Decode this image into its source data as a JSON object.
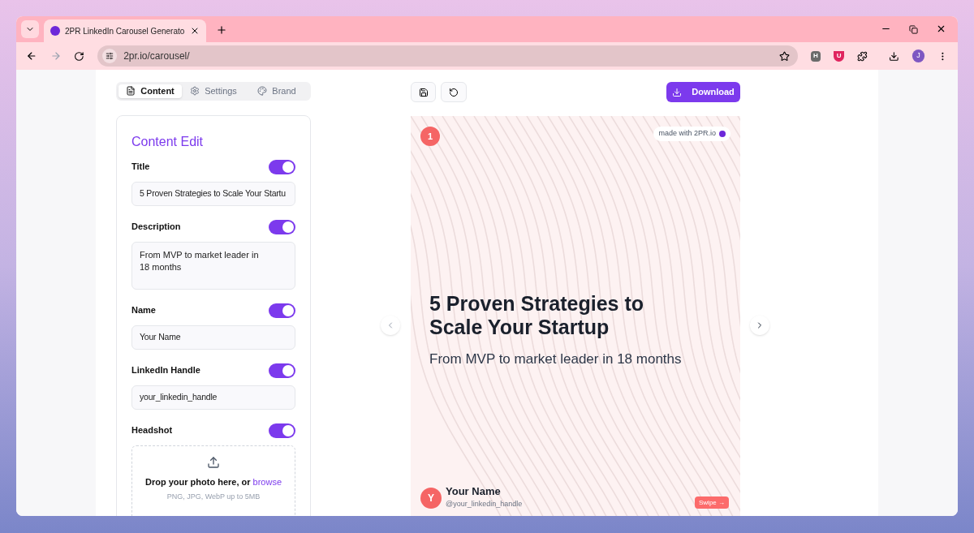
{
  "browser": {
    "tab_title": "2PR LinkedIn Carousel Generato",
    "url": "2pr.io/carousel/",
    "extensions": [
      {
        "label": "H",
        "color": "#6b6b6b"
      },
      {
        "label": "U",
        "color": "#e0245e"
      }
    ],
    "profile_initial": "J"
  },
  "editor_tabs": [
    {
      "label": "Content",
      "selected": true
    },
    {
      "label": "Settings",
      "selected": false
    },
    {
      "label": "Brand",
      "selected": false
    }
  ],
  "content_edit": {
    "heading": "Content Edit",
    "fields": [
      {
        "label": "Title",
        "on": true,
        "kind": "input",
        "value": "5 Proven Strategies to Scale Your Startu"
      },
      {
        "label": "Description",
        "on": true,
        "kind": "textarea",
        "value": "From MVP to market leader in 18 months"
      },
      {
        "label": "Name",
        "on": true,
        "kind": "input",
        "value": "Your Name"
      },
      {
        "label": "LinkedIn Handle",
        "on": true,
        "kind": "input",
        "value": "your_linkedin_handle"
      },
      {
        "label": "Headshot",
        "on": true,
        "kind": "upload",
        "drop_text": "Drop your photo here, or",
        "link": "browse",
        "hint": "PNG, JPG, WebP up to 5MB"
      }
    ]
  },
  "toolbar": {
    "download": "Download"
  },
  "slide": {
    "number": "1",
    "badge": "made with 2PR.io",
    "title": "5 Proven Strategies to Scale Your Startup",
    "subtitle": "From MVP to market leader in 18 months",
    "author_initial": "Y",
    "author_name": "Your Name",
    "handle": "@your_linkedin_handle",
    "swipe": "Swipe →"
  }
}
